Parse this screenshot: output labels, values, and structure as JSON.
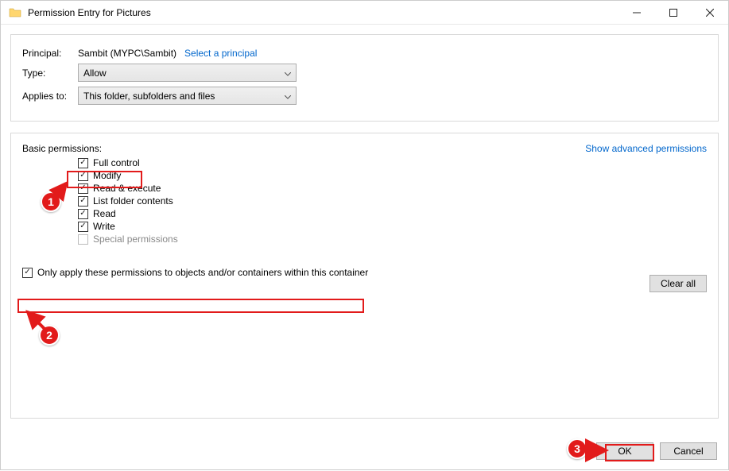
{
  "titlebar": {
    "title": "Permission Entry for Pictures"
  },
  "panel1": {
    "principal_label": "Principal:",
    "principal_value": "Sambit (MYPC\\Sambit)",
    "select_principal_link": "Select a principal",
    "type_label": "Type:",
    "type_value": "Allow",
    "applies_label": "Applies to:",
    "applies_value": "This folder, subfolders and files"
  },
  "panel2": {
    "basic_label": "Basic permissions:",
    "advanced_link": "Show advanced permissions",
    "perms": {
      "full": "Full control",
      "modify": "Modify",
      "readexec": "Read & execute",
      "listfolder": "List folder contents",
      "read": "Read",
      "write": "Write",
      "special": "Special permissions"
    },
    "only_apply": "Only apply these permissions to objects and/or containers within this container",
    "clear": "Clear all"
  },
  "footer": {
    "ok": "OK",
    "cancel": "Cancel"
  },
  "annot": {
    "b1": "1",
    "b2": "2",
    "b3": "3"
  }
}
